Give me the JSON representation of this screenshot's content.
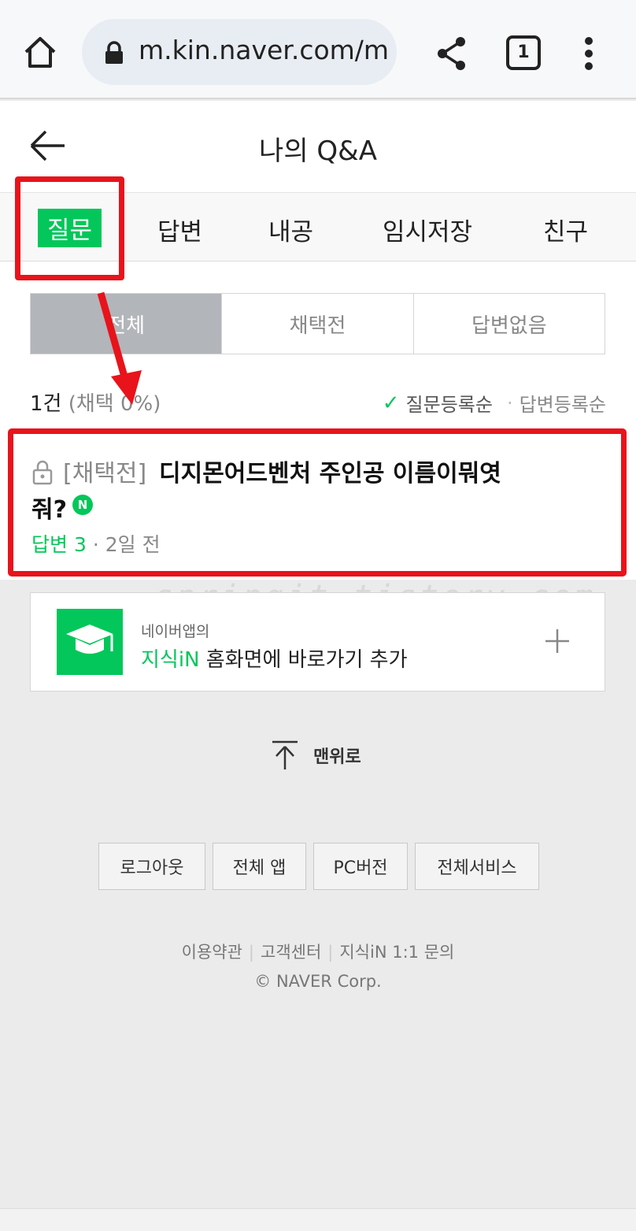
{
  "browser": {
    "url": "m.kin.naver.com/m",
    "tab_count": "1",
    "icons": [
      "home-icon",
      "lock-icon",
      "share-icon",
      "more-icon"
    ]
  },
  "header": {
    "title": "나의 Q&A"
  },
  "main_tabs": [
    {
      "label": "질문",
      "active": true
    },
    {
      "label": "답변"
    },
    {
      "label": "내공"
    },
    {
      "label": "임시저장"
    },
    {
      "label": "친구"
    }
  ],
  "filters": [
    {
      "label": "전체",
      "selected": true
    },
    {
      "label": "채택전"
    },
    {
      "label": "답변없음"
    }
  ],
  "summary": {
    "count": "1건",
    "rate": "(채택 0%)"
  },
  "sort": {
    "active": "질문등록순",
    "inactive": "답변등록순"
  },
  "question": {
    "status": "[채택전]",
    "title_line1": "디지몬어드벤처 주인공 이름이뭐엿",
    "title_line2": "줘?",
    "badge": "N",
    "answers": "답변 3",
    "time": "2일 전"
  },
  "shortcut": {
    "sub": "네이버앱의",
    "brand": "지식iN",
    "main": " 홈화면에 바로가기 추가"
  },
  "top_button": "맨위로",
  "footer_buttons": [
    "로그아웃",
    "전체 앱",
    "PC버전",
    "전체서비스"
  ],
  "footer_links": [
    "이용약관",
    "고객센터",
    "지식iN 1:1 문의"
  ],
  "copyright": "© NAVER Corp.",
  "watermark": "springit.tistory.com",
  "colors": {
    "accent": "#03c75a",
    "annotation": "#e8131b"
  }
}
